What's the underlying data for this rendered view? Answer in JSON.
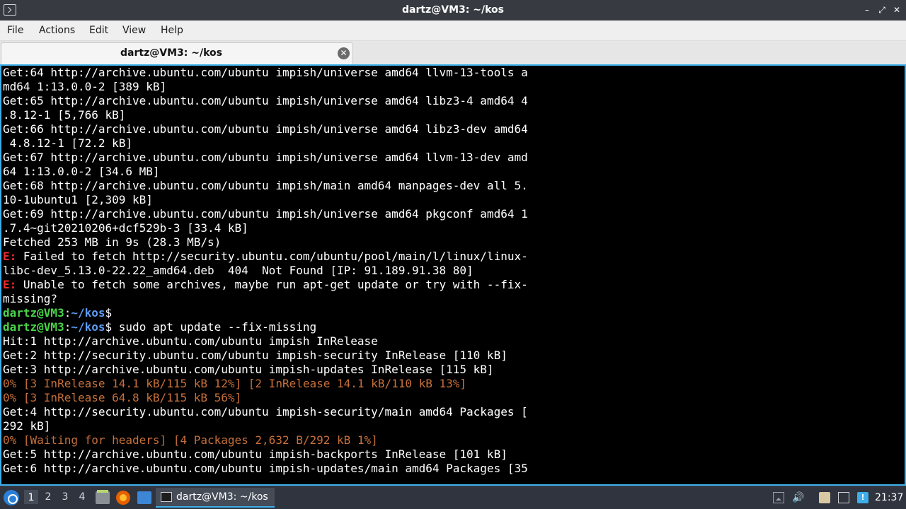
{
  "window": {
    "title": "dartz@VM3: ~/kos",
    "minimize": "–",
    "maximize": "⤢",
    "close": "✕"
  },
  "menu": [
    "File",
    "Actions",
    "Edit",
    "View",
    "Help"
  ],
  "tab": {
    "label": "dartz@VM3: ~/kos",
    "close": "✕"
  },
  "terminal": {
    "lines": [
      {
        "type": "plain",
        "text": "Get:64 http://archive.ubuntu.com/ubuntu impish/universe amd64 llvm-13-tools a"
      },
      {
        "type": "plain",
        "text": "md64 1:13.0.0-2 [389 kB]"
      },
      {
        "type": "plain",
        "text": "Get:65 http://archive.ubuntu.com/ubuntu impish/universe amd64 libz3-4 amd64 4"
      },
      {
        "type": "plain",
        "text": ".8.12-1 [5,766 kB]"
      },
      {
        "type": "plain",
        "text": "Get:66 http://archive.ubuntu.com/ubuntu impish/universe amd64 libz3-dev amd64"
      },
      {
        "type": "plain",
        "text": " 4.8.12-1 [72.2 kB]"
      },
      {
        "type": "plain",
        "text": "Get:67 http://archive.ubuntu.com/ubuntu impish/universe amd64 llvm-13-dev amd"
      },
      {
        "type": "plain",
        "text": "64 1:13.0.0-2 [34.6 MB]"
      },
      {
        "type": "plain",
        "text": "Get:68 http://archive.ubuntu.com/ubuntu impish/main amd64 manpages-dev all 5."
      },
      {
        "type": "plain",
        "text": "10-1ubuntu1 [2,309 kB]"
      },
      {
        "type": "plain",
        "text": "Get:69 http://archive.ubuntu.com/ubuntu impish/universe amd64 pkgconf amd64 1"
      },
      {
        "type": "plain",
        "text": ".7.4~git20210206+dcf529b-3 [33.4 kB]"
      },
      {
        "type": "plain",
        "text": "Fetched 253 MB in 9s (28.3 MB/s)"
      },
      {
        "type": "error",
        "prefix": "E:",
        "text": " Failed to fetch http://security.ubuntu.com/ubuntu/pool/main/l/linux/linux-"
      },
      {
        "type": "plain",
        "text": "libc-dev_5.13.0-22.22_amd64.deb  404  Not Found [IP: 91.189.91.38 80]"
      },
      {
        "type": "error",
        "prefix": "E:",
        "text": " Unable to fetch some archives, maybe run apt-get update or try with --fix-"
      },
      {
        "type": "plain",
        "text": "missing?"
      },
      {
        "type": "prompt",
        "user": "dartz@VM3",
        "sep": ":",
        "dir": "~/kos",
        "sym": "$",
        "cmd": ""
      },
      {
        "type": "prompt",
        "user": "dartz@VM3",
        "sep": ":",
        "dir": "~/kos",
        "sym": "$",
        "cmd": " sudo apt update --fix-missing"
      },
      {
        "type": "plain",
        "text": "Hit:1 http://archive.ubuntu.com/ubuntu impish InRelease"
      },
      {
        "type": "plain",
        "text": "Get:2 http://security.ubuntu.com/ubuntu impish-security InRelease [110 kB]"
      },
      {
        "type": "plain",
        "text": "Get:3 http://archive.ubuntu.com/ubuntu impish-updates InRelease [115 kB]"
      },
      {
        "type": "progress",
        "text": "0% [3 InRelease 14.1 kB/115 kB 12%] [2 InRelease 14.1 kB/110 kB 13%]"
      },
      {
        "type": "progress",
        "text": "0% [3 InRelease 64.8 kB/115 kB 56%]"
      },
      {
        "type": "plain",
        "text": "Get:4 http://security.ubuntu.com/ubuntu impish-security/main amd64 Packages ["
      },
      {
        "type": "plain",
        "text": "292 kB]"
      },
      {
        "type": "progress",
        "text": "0% [Waiting for headers] [4 Packages 2,632 B/292 kB 1%]"
      },
      {
        "type": "plain",
        "text": "Get:5 http://archive.ubuntu.com/ubuntu impish-backports InRelease [101 kB]"
      },
      {
        "type": "plain",
        "text": "Get:6 http://archive.ubuntu.com/ubuntu impish-updates/main amd64 Packages [35"
      }
    ]
  },
  "taskbar": {
    "workspaces": [
      "1",
      "2",
      "3",
      "4"
    ],
    "active_workspace": "1",
    "task_label": "dartz@VM3: ~/kos",
    "volume_icon": "🔊",
    "update_badge": "!",
    "clock": "21:37"
  }
}
